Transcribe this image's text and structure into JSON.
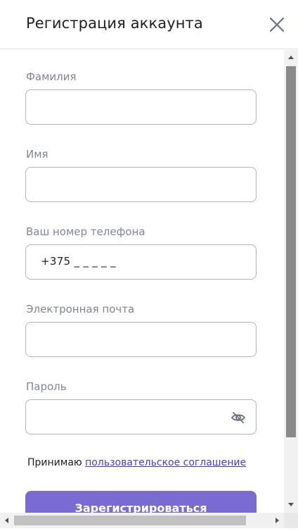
{
  "dialog": {
    "title": "Регистрация аккаунта",
    "close_icon": "close-icon"
  },
  "form": {
    "last_name": {
      "label": "Фамилия",
      "value": ""
    },
    "first_name": {
      "label": "Имя",
      "value": ""
    },
    "phone": {
      "label": "Ваш номер телефона",
      "value": "+375 _ _ _ _ _"
    },
    "email": {
      "label": "Электронная почта",
      "value": ""
    },
    "password": {
      "label": "Пароль",
      "value": "",
      "toggle_icon": "eye-hidden-icon"
    },
    "agreement": {
      "text": "Принимаю",
      "link": "пользовательское соглашение"
    },
    "submit_label": "Зарегистрироваться"
  },
  "colors": {
    "accent": "#7a6bd3",
    "link": "#4a3bd1",
    "label": "#828597",
    "border": "#b3b3bf"
  }
}
